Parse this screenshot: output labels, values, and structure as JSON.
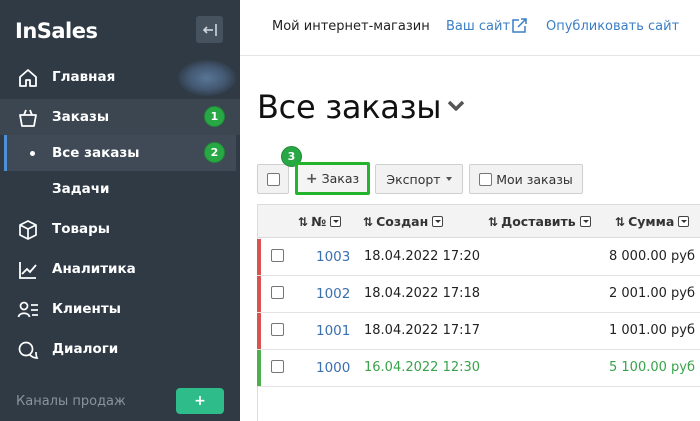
{
  "sidebar": {
    "logo": "InSales",
    "items": [
      {
        "label": "Главная",
        "icon": "home-icon"
      },
      {
        "label": "Заказы",
        "icon": "basket-icon",
        "badge": "1"
      },
      {
        "label": "Все заказы",
        "badge": "2"
      },
      {
        "label": "Задачи"
      },
      {
        "label": "Товары",
        "icon": "box-icon"
      },
      {
        "label": "Аналитика",
        "icon": "chart-icon"
      },
      {
        "label": "Клиенты",
        "icon": "clients-icon"
      },
      {
        "label": "Диалоги",
        "icon": "chat-icon"
      }
    ],
    "channels_label": "Каналы продаж",
    "add_channel": "+"
  },
  "topbar": {
    "store_name": "Мой интернет-магазин",
    "your_site": "Ваш сайт",
    "publish": "Опубликовать сайт"
  },
  "main": {
    "title": "Все заказы",
    "step3": "3",
    "toolbar": {
      "add_order": "Заказ",
      "export": "Экспорт",
      "my_orders": "Мои заказы"
    },
    "table": {
      "headers": [
        "№",
        "Создан",
        "Доставить",
        "Сумма"
      ],
      "rows": [
        {
          "num": "1003",
          "created": "18.04.2022 17:20",
          "sum": "8 000.00 руб",
          "status_color": "#d9534f"
        },
        {
          "num": "1002",
          "created": "18.04.2022 17:18",
          "sum": "2 001.00 руб",
          "status_color": "#d9534f"
        },
        {
          "num": "1001",
          "created": "18.04.2022 17:17",
          "sum": "1 001.00 руб",
          "status_color": "#d9534f"
        },
        {
          "num": "1000",
          "created": "16.04.2022 12:30",
          "sum": "5 100.00 руб",
          "status_color": "#4cae4c"
        }
      ]
    }
  },
  "colors": {
    "sidebar_bg": "#2f3a45",
    "accent_blue": "#3b7fc4",
    "step_green": "#28a745",
    "add_channel_green": "#2ebc8a"
  }
}
